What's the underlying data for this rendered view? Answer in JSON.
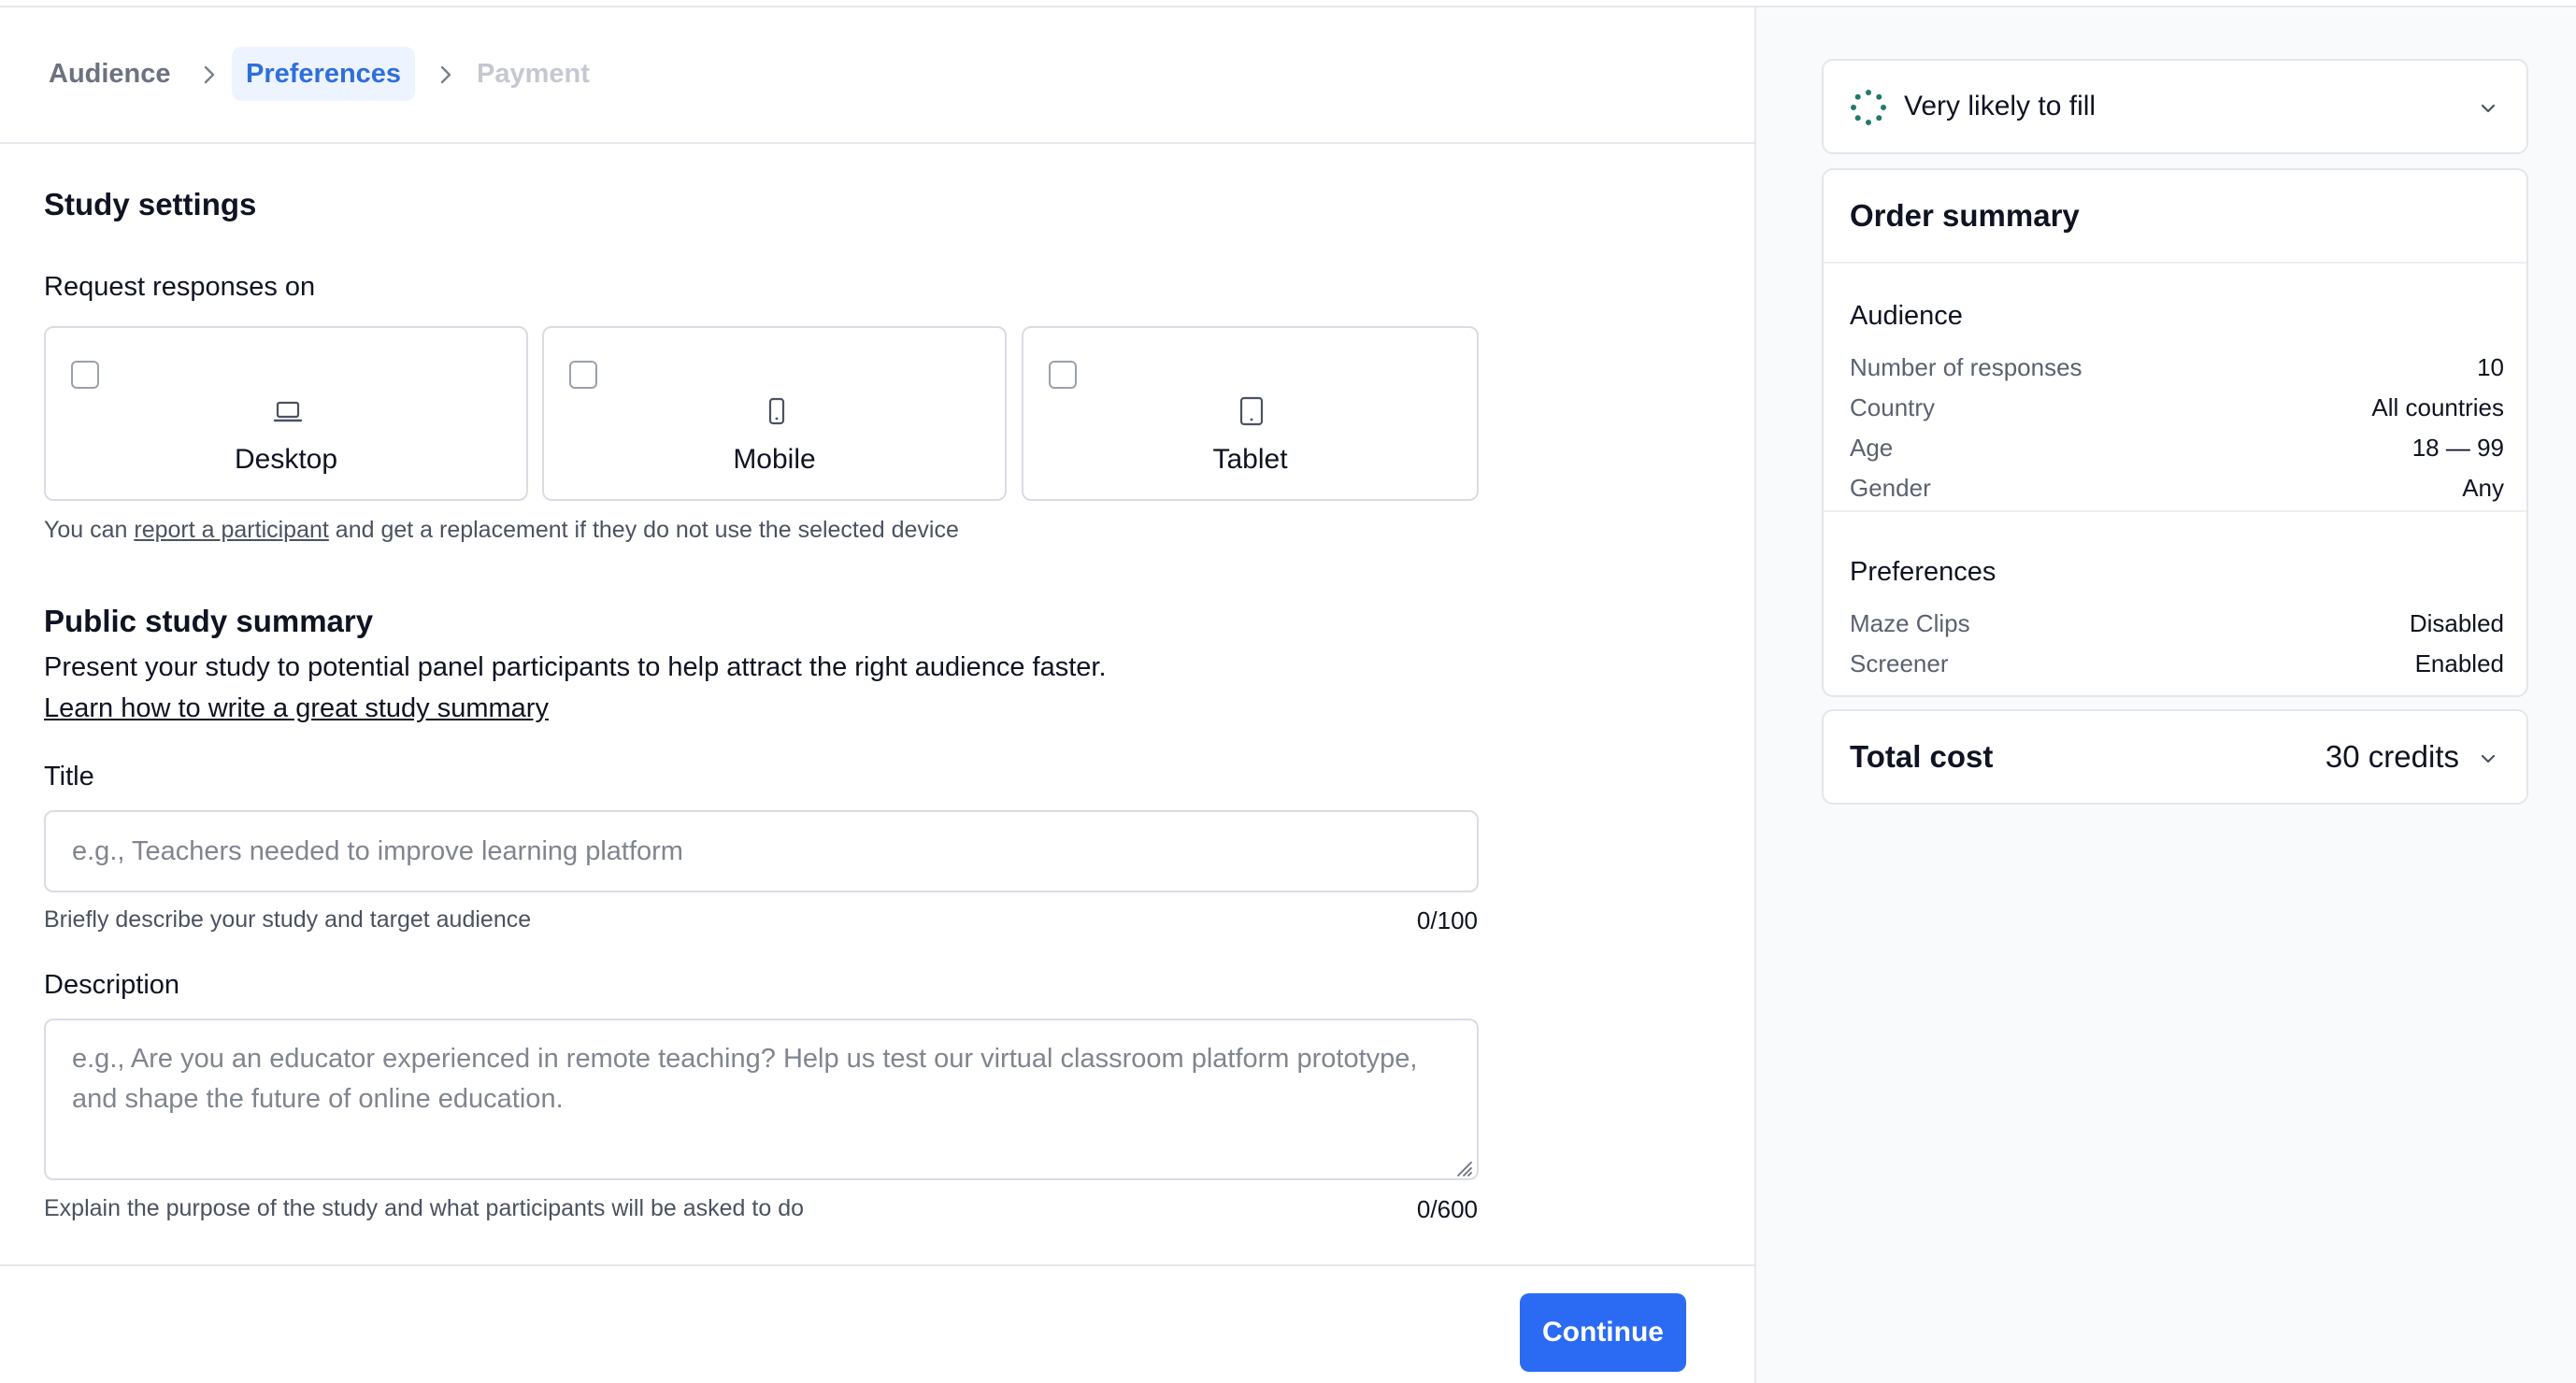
{
  "breadcrumb": {
    "steps": [
      {
        "label": "Audience",
        "state": "done"
      },
      {
        "label": "Preferences",
        "state": "active"
      },
      {
        "label": "Payment",
        "state": "upcoming"
      }
    ]
  },
  "study_settings": {
    "title": "Study settings",
    "request_label": "Request responses on",
    "devices": [
      {
        "label": "Desktop",
        "icon": "laptop-icon",
        "checked": false
      },
      {
        "label": "Mobile",
        "icon": "mobile-icon",
        "checked": false
      },
      {
        "label": "Tablet",
        "icon": "tablet-icon",
        "checked": false
      }
    ],
    "hint_prefix": "You can ",
    "hint_link": "report a participant",
    "hint_suffix": " and get a replacement if they do not use the selected device"
  },
  "public_summary": {
    "title": "Public study summary",
    "description": "Present your study to potential panel participants to help attract the right audience faster.",
    "learn_link": "Learn how to write a great study summary",
    "title_field": {
      "label": "Title",
      "value": "",
      "placeholder": "e.g., Teachers needed to improve learning platform",
      "helper": "Briefly describe your study and target audience",
      "counter": "0/100"
    },
    "description_field": {
      "label": "Description",
      "value": "",
      "placeholder": "e.g., Are you an educator experienced in remote teaching? Help us test our virtual classroom platform prototype, and shape the future of online education.",
      "helper": "Explain the purpose of the study and what participants will be asked to do",
      "counter": "0/600"
    }
  },
  "footer": {
    "continue_label": "Continue",
    "accent": "#2b6bf3"
  },
  "sidebar": {
    "fill_status": "Very likely to fill",
    "order_summary": {
      "title": "Order summary",
      "audience_heading": "Audience",
      "audience": [
        {
          "key": "Number of responses",
          "value": "10"
        },
        {
          "key": "Country",
          "value": "All countries"
        },
        {
          "key": "Age",
          "value": "18 — 99"
        },
        {
          "key": "Gender",
          "value": "Any"
        }
      ],
      "preferences_heading": "Preferences",
      "preferences": [
        {
          "key": "Maze Clips",
          "value": "Disabled"
        },
        {
          "key": "Screener",
          "value": "Enabled"
        }
      ]
    },
    "total": {
      "label": "Total cost",
      "value": "30 credits"
    }
  }
}
